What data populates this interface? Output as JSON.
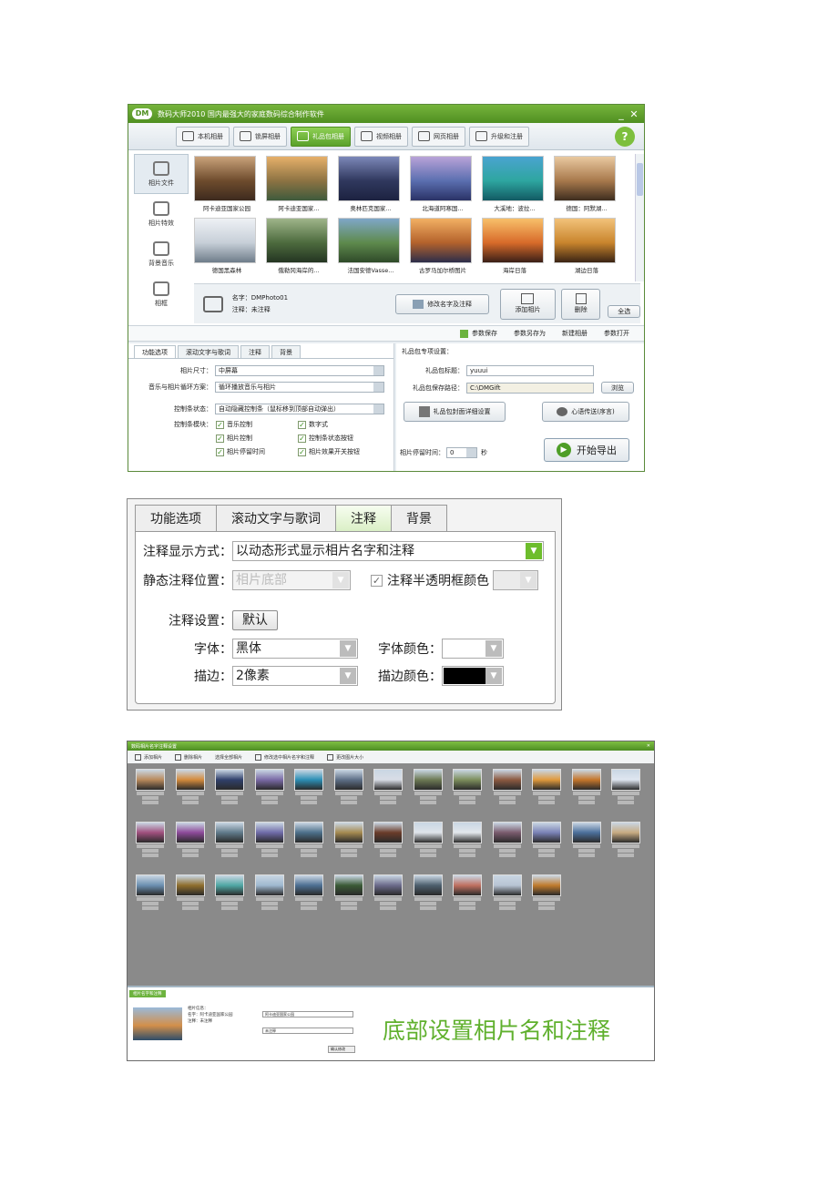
{
  "shot1": {
    "window_title": "数码大师2010  国内最强大的家庭数码综合制作软件",
    "window_minimize": "_",
    "window_close": "✕",
    "tabs": [
      {
        "label": "本机相册"
      },
      {
        "label": "锁屏相册"
      },
      {
        "label": "礼品包相册"
      },
      {
        "label": "视频相册"
      },
      {
        "label": "网页相册"
      },
      {
        "label": "升级和注册"
      }
    ],
    "help_label": "?",
    "left_nav": [
      {
        "label": "相片文件"
      },
      {
        "label": "相片特效"
      },
      {
        "label": "背景音乐"
      },
      {
        "label": "相框"
      }
    ],
    "photos": [
      {
        "caption": "阿卡迪亚国家公园",
        "colors": [
          "#c9a27a",
          "#6e4c2d",
          "#3d2a1e"
        ]
      },
      {
        "caption": "阿卡迪亚国家...",
        "colors": [
          "#e6b06a",
          "#8d7343",
          "#3e5a3c"
        ]
      },
      {
        "caption": "奥林匹克国家...",
        "colors": [
          "#7c88b8",
          "#30385e",
          "#1c2240"
        ]
      },
      {
        "caption": "北海道阿寒国...",
        "colors": [
          "#b9a3d8",
          "#5b6fb0",
          "#2a3266"
        ]
      },
      {
        "caption": "大溪地：波拉...",
        "colors": [
          "#4aa3d0",
          "#2ea6a0",
          "#125a63"
        ]
      },
      {
        "caption": "德国：阿默湖...",
        "colors": [
          "#e9c9a0",
          "#a8794c",
          "#3e2d1f"
        ]
      },
      {
        "caption": "德国黑森林",
        "colors": [
          "#eef1f5",
          "#c7cfd8",
          "#6f7d8a"
        ]
      },
      {
        "caption": "俄勒冈海岸的...",
        "colors": [
          "#9fb58a",
          "#4d6b3e",
          "#243522"
        ]
      },
      {
        "caption": "法国安德Vasse...",
        "colors": [
          "#7fa7c8",
          "#5e8a4d",
          "#2f4a29"
        ]
      },
      {
        "caption": "古罗马加尔桥图片",
        "colors": [
          "#f2b063",
          "#b4622c",
          "#2c2d4a"
        ]
      },
      {
        "caption": "海岸日落",
        "colors": [
          "#f8c06a",
          "#d86b2a",
          "#3a1f17"
        ]
      },
      {
        "caption": "湖边日落",
        "colors": [
          "#f2c27a",
          "#c9852d",
          "#3a2414"
        ]
      }
    ],
    "info": {
      "name_line": "名字：DMPhoto01",
      "note_line": "注释：未注释"
    },
    "buttons": {
      "edit_name": "修改名字及注释",
      "add_photo": "添加相片",
      "delete": "删除",
      "select_all": "全选"
    },
    "toolbar2": [
      "参数保存",
      "参数另存为",
      "新建相册",
      "参数打开"
    ],
    "lower_tabs": [
      "功能选项",
      "滚动文字与歌词",
      "注释",
      "背景"
    ],
    "form": {
      "size_label": "相片尺寸：",
      "size_value": "中屏幕",
      "loop_label": "音乐与相片循环方案：",
      "loop_value": "循环播放音乐与相片",
      "control_label": "控制条状态：",
      "control_value": "自动隐藏控制条（鼠标移到顶部自动弹出）",
      "module_label": "控制条模块：",
      "checks": [
        "音乐控制",
        "数字式",
        "相片控制",
        "控制条状态按钮",
        "相片停留时间",
        "相片效果开关按钮"
      ]
    },
    "right_panel": {
      "title": "礼品包专项设置：",
      "gift_title_label": "礼品包标题：",
      "gift_title_value": "yuuui",
      "save_path_label": "礼品包保存路径：",
      "save_path_value": "C:\\DMGift",
      "browse": "浏览",
      "cover_btn": "礼品包封面详细设置",
      "wish_btn": "心语传送(序言)",
      "stay_label": "相片停留时间：",
      "stay_value": "0",
      "stay_unit": "秒",
      "export": "开始导出"
    }
  },
  "shot2": {
    "tabs": [
      "功能选项",
      "滚动文字与歌词",
      "注释",
      "背景"
    ],
    "active_tab": "注释",
    "display_mode_label": "注释显示方式：",
    "display_mode_value": "以动态形式显示相片名字和注释",
    "static_pos_label": "静态注释位置：",
    "static_pos_value": "相片底部",
    "semi_checkbox": "注释半透明框颜色",
    "settings_label": "注释设置：",
    "default_btn": "默认",
    "font_label": "字体：",
    "font_value": "黑体",
    "font_color_label": "字体颜色：",
    "stroke_label": "描边：",
    "stroke_value": "2像素",
    "stroke_color_label": "描边颜色：",
    "stroke_color": "#000000"
  },
  "shot3": {
    "title": "数码相片名字注释设置",
    "close": "✕",
    "tools": [
      "添加相片",
      "删除相片",
      "选择全部相片",
      "修改选中相片名字和注释",
      "更改图片大小"
    ],
    "photo_colors": [
      "#b98a5c",
      "#d48b3c",
      "#30406b",
      "#7a6aa6",
      "#2c8fb5",
      "#5e6f87",
      "#d9dde6",
      "#6d7a55",
      "#7d8f5d",
      "#8d5a41",
      "#e09a3d",
      "#c5762b",
      "#dfe6f0",
      "#a0507e",
      "#8e4a9a",
      "#607a8a",
      "#6f6ba8",
      "#4c6f8a",
      "#a58a50",
      "#6a3c2a",
      "#dfe4ea",
      "#e3e7ec",
      "#7a5b6d",
      "#7a82b6",
      "#4b6f9b",
      "#c8ab82",
      "#6b8fb0",
      "#8f6e2d",
      "#4fa7a4",
      "#9fb9d0",
      "#4d6f92",
      "#3b5a36",
      "#6b6a8a",
      "#4d5f6d",
      "#c07060",
      "#b8c4d4",
      "#c07b2d"
    ],
    "tab": "相片名字和注释",
    "info_lines": [
      "相片信息：",
      "名字：阿卡迪亚国家公园",
      "注释：未注释"
    ],
    "name_input": "阿卡迪亚国家公园",
    "note_input": "未注释",
    "confirm_btn": "确认修改",
    "hint": "底部设置相片名和注释"
  }
}
